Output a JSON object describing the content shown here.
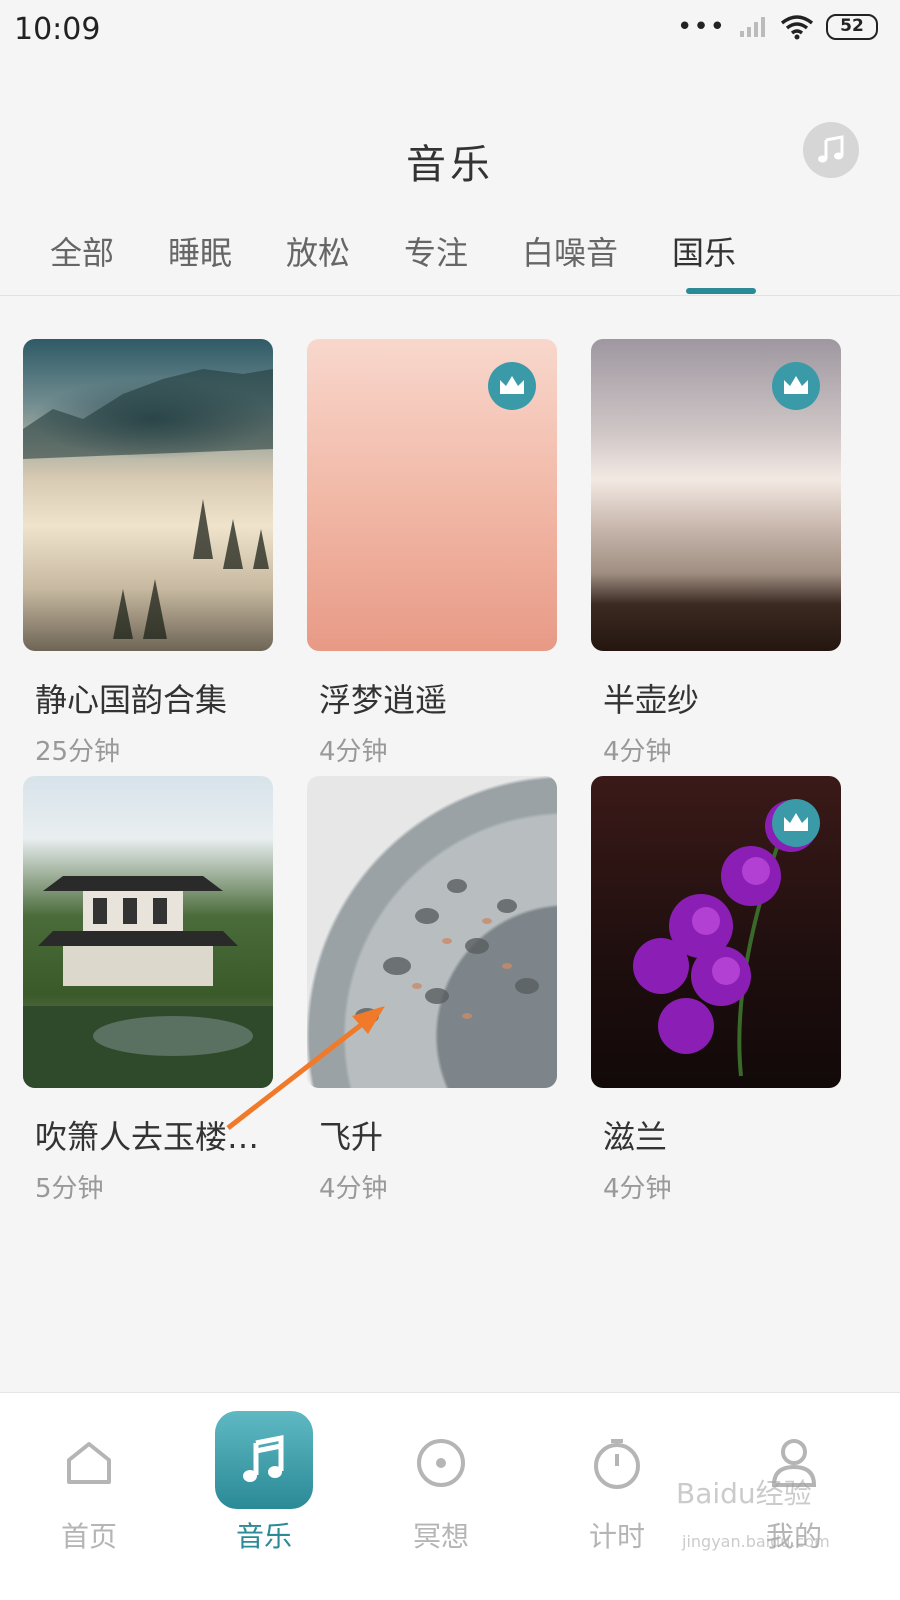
{
  "status_bar": {
    "time": "10:09",
    "dots": "•••",
    "battery": "52"
  },
  "header": {
    "title": "音乐"
  },
  "tabs": [
    {
      "label": "全部"
    },
    {
      "label": "睡眠"
    },
    {
      "label": "放松"
    },
    {
      "label": "专注"
    },
    {
      "label": "白噪音"
    },
    {
      "label": "国乐"
    }
  ],
  "active_tab": "国乐",
  "cards": [
    {
      "title": "静心国韵合集",
      "duration": "25分钟",
      "premium": false
    },
    {
      "title": "浮梦逍遥",
      "duration": "4分钟",
      "premium": true
    },
    {
      "title": "半壶纱",
      "duration": "4分钟",
      "premium": true
    },
    {
      "title": "吹箫人去玉楼…",
      "duration": "5分钟",
      "premium": false
    },
    {
      "title": "飞升",
      "duration": "4分钟",
      "premium": false
    },
    {
      "title": "滋兰",
      "duration": "4分钟",
      "premium": true
    }
  ],
  "bottom_nav": [
    {
      "label": "首页",
      "icon": "home-icon"
    },
    {
      "label": "音乐",
      "icon": "music-note-icon"
    },
    {
      "label": "冥想",
      "icon": "meditation-icon"
    },
    {
      "label": "计时",
      "icon": "timer-icon"
    },
    {
      "label": "我的",
      "icon": "profile-icon"
    }
  ],
  "watermark": {
    "text": "Baidu经验",
    "sub": "jingyan.baidu.com"
  },
  "colors": {
    "accent": "#2a8a96",
    "background": "#f5f5f5"
  }
}
